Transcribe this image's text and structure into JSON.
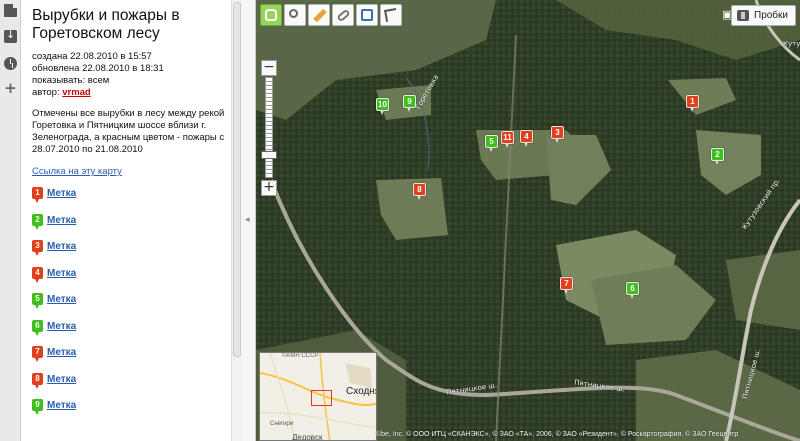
{
  "sidebar_icons": [
    "document-icon",
    "download-icon",
    "clock-icon",
    "plus-icon"
  ],
  "panel": {
    "title": "Вырубки и пожары в Горетовском лесу",
    "created": "создана 22.08.2010 в 15:57",
    "updated": "обновлена 22.08.2010 в 18:31",
    "show": "показывать: всем",
    "author_label": "автор: ",
    "author": "vrmad",
    "description": "Отмечены все вырубки в лесу между рекой Горетовка и Пятницким шоссе вблизи г. Зеленограда, а красным цветом - пожары с 28.07.2010 по 21.08.2010",
    "map_link": "Ссылка на эту карту",
    "markers": [
      {
        "num": "1",
        "label": "Метка",
        "color": "#e0401c"
      },
      {
        "num": "2",
        "label": "Метка",
        "color": "#3fbf1e"
      },
      {
        "num": "3",
        "label": "Метка",
        "color": "#e0401c"
      },
      {
        "num": "4",
        "label": "Метка",
        "color": "#e0401c"
      },
      {
        "num": "5",
        "label": "Метка",
        "color": "#3fbf1e"
      },
      {
        "num": "6",
        "label": "Метка",
        "color": "#3fbf1e"
      },
      {
        "num": "7",
        "label": "Метка",
        "color": "#e0401c"
      },
      {
        "num": "8",
        "label": "Метка",
        "color": "#e0401c"
      },
      {
        "num": "9",
        "label": "Метка",
        "color": "#3fbf1e"
      }
    ]
  },
  "map": {
    "toolbar": [
      "hand-icon",
      "zoom-icon",
      "ruler-icon",
      "link-icon",
      "print-icon",
      "cursor-icon"
    ],
    "traffic_label": "Пробки",
    "road_labels": {
      "top_right": "Кутуз",
      "river": "Горетовка",
      "kutuz_pr": "Кутузовский пр.",
      "pyatn1": "Пятницкое ш.",
      "pyatn2": "Пятницкое ш.",
      "pyatn_bottom": "Пятницкое ш."
    },
    "map_markers": [
      {
        "num": "1",
        "color": "#e0401c"
      },
      {
        "num": "2",
        "color": "#3fbf1e"
      },
      {
        "num": "3",
        "color": "#e0401c"
      },
      {
        "num": "4",
        "color": "#e0401c"
      },
      {
        "num": "5",
        "color": "#3fbf1e"
      },
      {
        "num": "6",
        "color": "#3fbf1e"
      },
      {
        "num": "7",
        "color": "#e0401c"
      },
      {
        "num": "8",
        "color": "#e0401c"
      },
      {
        "num": "9",
        "color": "#3fbf1e"
      },
      {
        "num": "10",
        "color": "#3fbf1e"
      },
      {
        "num": "11",
        "color": "#e0401c"
      }
    ],
    "minimap": {
      "header": "©АМН СССР",
      "city": "Сходня",
      "town": "Снегири",
      "bottom": "Дедовск"
    },
    "copyright": "©be, Inc. © ООО ИТЦ «СКАНЭКС», © ЗАО «ТА», 2006, © ЗАО «Резидент», © Роскартография, © ЗАО Геоцентр"
  }
}
